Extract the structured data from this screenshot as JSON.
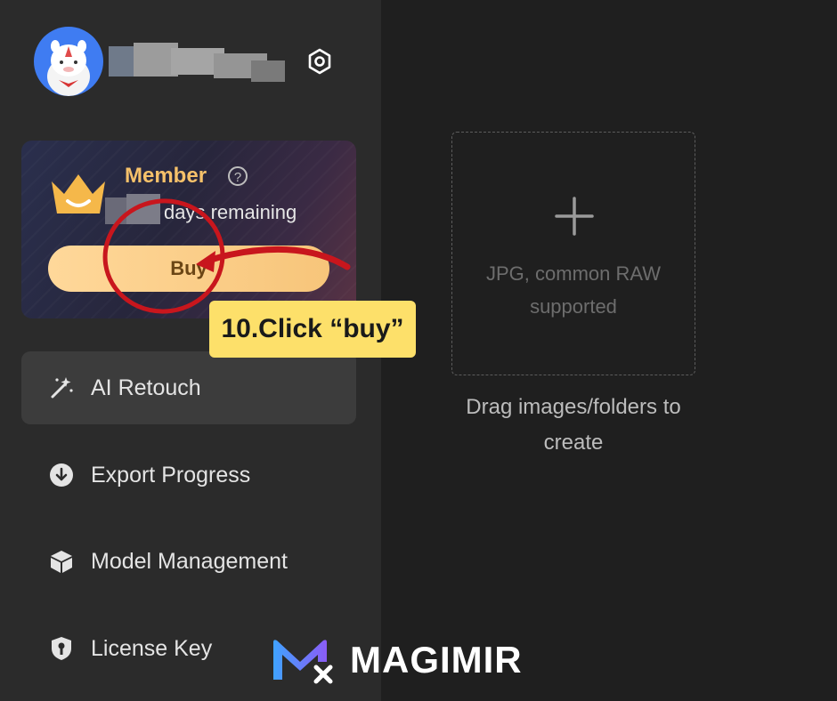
{
  "sidebar": {
    "member": {
      "title": "Member",
      "help_symbol": "?",
      "days_text": "days remaining",
      "buy_label": "Buy"
    },
    "nav": [
      {
        "label": "AI Retouch",
        "icon": "magic-wand-icon",
        "active": true
      },
      {
        "label": "Export Progress",
        "icon": "download-circle-icon",
        "active": false
      },
      {
        "label": "Model Management",
        "icon": "cube-icon",
        "active": false
      },
      {
        "label": "License Key",
        "icon": "key-shield-icon",
        "active": false
      }
    ]
  },
  "main": {
    "drop_hint": "JPG, common RAW supported",
    "drag_text": "Drag images/folders to create"
  },
  "annotation": {
    "callout": "10.Click “buy”"
  },
  "brand": {
    "name": "MAGIMIR"
  },
  "colors": {
    "accent_gold": "#f6c16a",
    "callout_yellow": "#fde06a",
    "annotation_red": "#c8161d",
    "avatar_blue": "#3f7cf2"
  }
}
